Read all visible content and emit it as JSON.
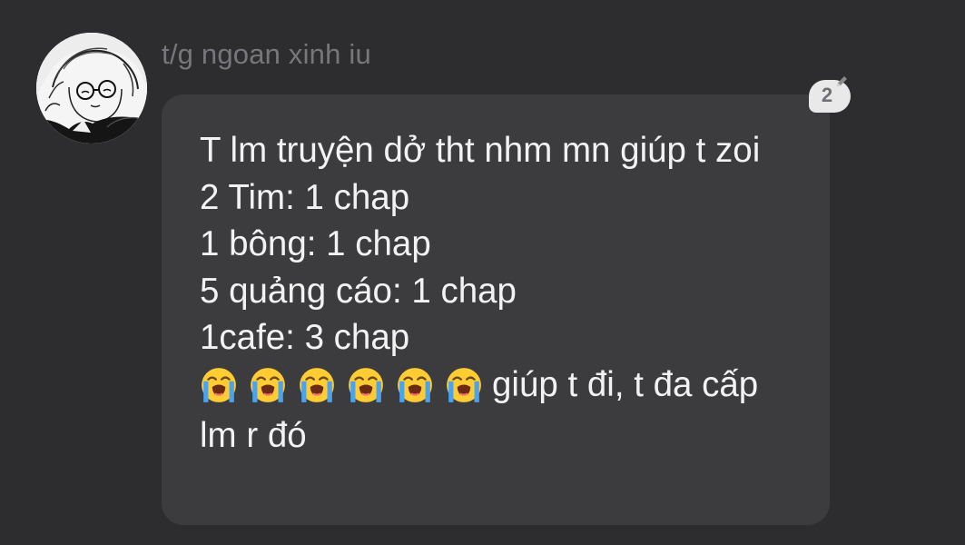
{
  "sender": {
    "name": "t/g ngoan xinh iu"
  },
  "message": {
    "lines": [
      "T lm truyện dở tht nhm mn giúp t zoi",
      "2 Tim: 1 chap",
      "1 bông: 1 chap",
      "5 quảng cáo: 1 chap",
      "1cafe: 3 chap"
    ],
    "emoji_icon": "loudly-crying-face",
    "emoji_count": 6,
    "closing": "giúp t đi, t đa cấp lm r đó"
  },
  "edit_badge": {
    "count": "2",
    "icon": "pencil-icon"
  },
  "colors": {
    "background": "#2d2d2f",
    "bubble": "#3c3c3f",
    "text": "#f2f2f2",
    "sender": "#77777b",
    "emoji_face": "#ffcc33",
    "emoji_tears": "#4aa3f0"
  }
}
